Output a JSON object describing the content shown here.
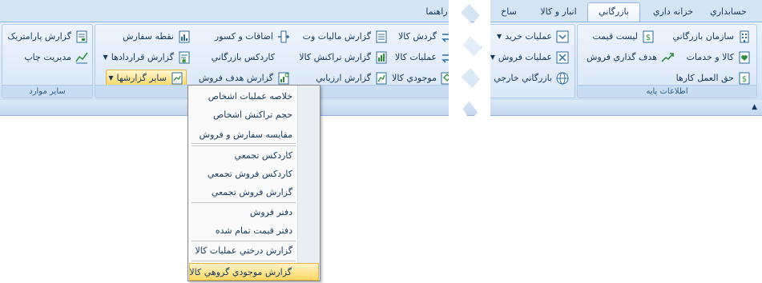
{
  "tabs": [
    {
      "label": "حسابداري",
      "active": false
    },
    {
      "label": "خزانه داري",
      "active": false
    },
    {
      "label": "بازرگاني",
      "active": true
    },
    {
      "label": "انبار و کالا",
      "active": false
    },
    {
      "label": "ساخ",
      "active": false
    },
    {
      "label": "راهنما",
      "active": false
    }
  ],
  "groups": {
    "base_info": {
      "title": "اطلاعات پايه",
      "items": [
        {
          "label": "سازمان بازرگاني",
          "icon": "building-icon"
        },
        {
          "label": "ليست قيمت",
          "icon": "price-list-icon"
        },
        {
          "label": "کالا و خدمات",
          "icon": "goods-heart-icon"
        },
        {
          "label": "هدف گذاري فروش",
          "icon": "trend-arrow-icon"
        },
        {
          "label": "حق العمل کارها",
          "icon": "dollar-doc-icon"
        }
      ]
    },
    "operations": {
      "items": [
        {
          "label": "عمليات خريد",
          "icon": "purchase-icon"
        },
        {
          "label": "عمليات فروش",
          "icon": "sales-icon"
        },
        {
          "label": "بازرگاني خارجي",
          "icon": "globe-icon"
        }
      ]
    },
    "reports": {
      "title": "گزارشهاي بازرگاني",
      "items": [
        {
          "label": "گردش کالا",
          "icon": "exchange-arrows-icon"
        },
        {
          "label": "عمليات کالا",
          "icon": "exchange-arrows-icon"
        },
        {
          "label": "موجودي کالا",
          "icon": "box-icon"
        },
        {
          "label": "گزارش ماليات وت",
          "icon": "report-list-icon"
        },
        {
          "label": "گزارش تراکنش کالا",
          "icon": "bar-chart-icon"
        },
        {
          "label": "گزارش ارزيابي",
          "icon": "evaluation-chart-icon"
        },
        {
          "label": "اضافات و کسور",
          "icon": "plus-minus-icon"
        },
        {
          "label": "کاردکس بازرگاني",
          "icon": ""
        },
        {
          "label": "گزارش هدف فروش",
          "icon": "target-report-icon"
        },
        {
          "label": "نقطه سفارش",
          "icon": "order-point-icon"
        },
        {
          "label": "گزارش قراردادها",
          "icon": "contract-icon"
        },
        {
          "label": "ساير گزارشها",
          "icon": "other-reports-icon"
        }
      ]
    },
    "other": {
      "title": "ساير موارد",
      "items": [
        {
          "label": "گزارش پارامتريک",
          "icon": "parametric-icon"
        },
        {
          "label": "مديريت چاپ",
          "icon": "print-chart-icon"
        }
      ]
    }
  },
  "menu": {
    "items": [
      {
        "label": "خلاصه عمليات اشخاص",
        "highlighted": false
      },
      {
        "label": "حجم تراکنش اشخاص",
        "highlighted": false
      },
      {
        "label": "مقايسه سفارش و فروش",
        "highlighted": false
      },
      {
        "label": "کاردکس تجمعي",
        "highlighted": false
      },
      {
        "label": "کاردکس فروش تجمعي",
        "highlighted": false
      },
      {
        "label": "گزارش فروش تجمعي",
        "highlighted": false
      },
      {
        "label": "دفتر فروش",
        "highlighted": false
      },
      {
        "label": "دفتر قيمت تمام شده",
        "highlighted": false
      },
      {
        "label": "گزارش درختي عمليات کالا",
        "highlighted": false
      },
      {
        "label": "گزارش موجودي گروهي کالا",
        "highlighted": true
      }
    ]
  },
  "colors": {
    "accent": "#15395f",
    "highlight": "#ffd762",
    "ribbon": "#dbe8f6"
  }
}
